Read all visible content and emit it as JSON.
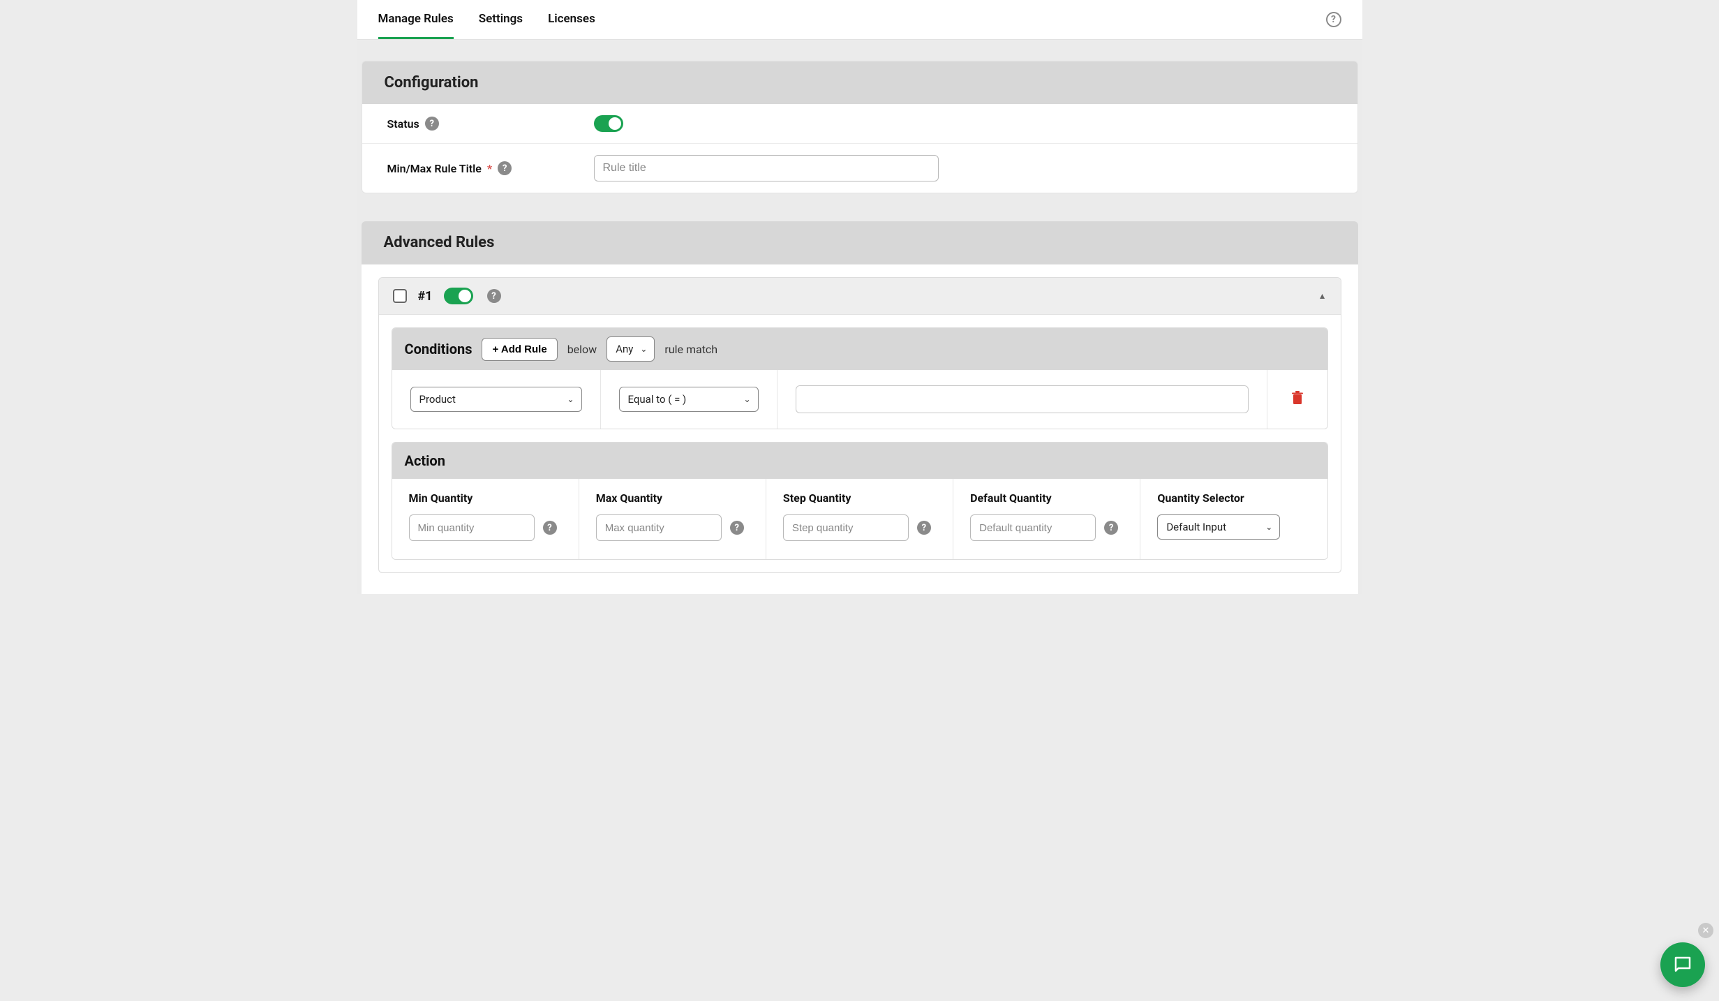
{
  "tabs": {
    "manage_rules": "Manage Rules",
    "settings": "Settings",
    "licenses": "Licenses"
  },
  "config": {
    "header": "Configuration",
    "status_label": "Status",
    "title_label": "Min/Max Rule Title",
    "title_required": "*",
    "title_placeholder": "Rule title"
  },
  "advanced": {
    "header": "Advanced Rules",
    "rule_number": "#1",
    "conditions": {
      "title": "Conditions",
      "add_rule_btn": "+ Add Rule",
      "below_text": "below",
      "match_select": "Any",
      "rule_match_text": "rule match",
      "field_select": "Product",
      "op_select": "Equal to ( = )"
    },
    "action": {
      "title": "Action",
      "min_label": "Min Quantity",
      "min_placeholder": "Min quantity",
      "max_label": "Max Quantity",
      "max_placeholder": "Max quantity",
      "step_label": "Step Quantity",
      "step_placeholder": "Step quantity",
      "default_label": "Default Quantity",
      "default_placeholder": "Default quantity",
      "selector_label": "Quantity Selector",
      "selector_value": "Default Input"
    }
  }
}
